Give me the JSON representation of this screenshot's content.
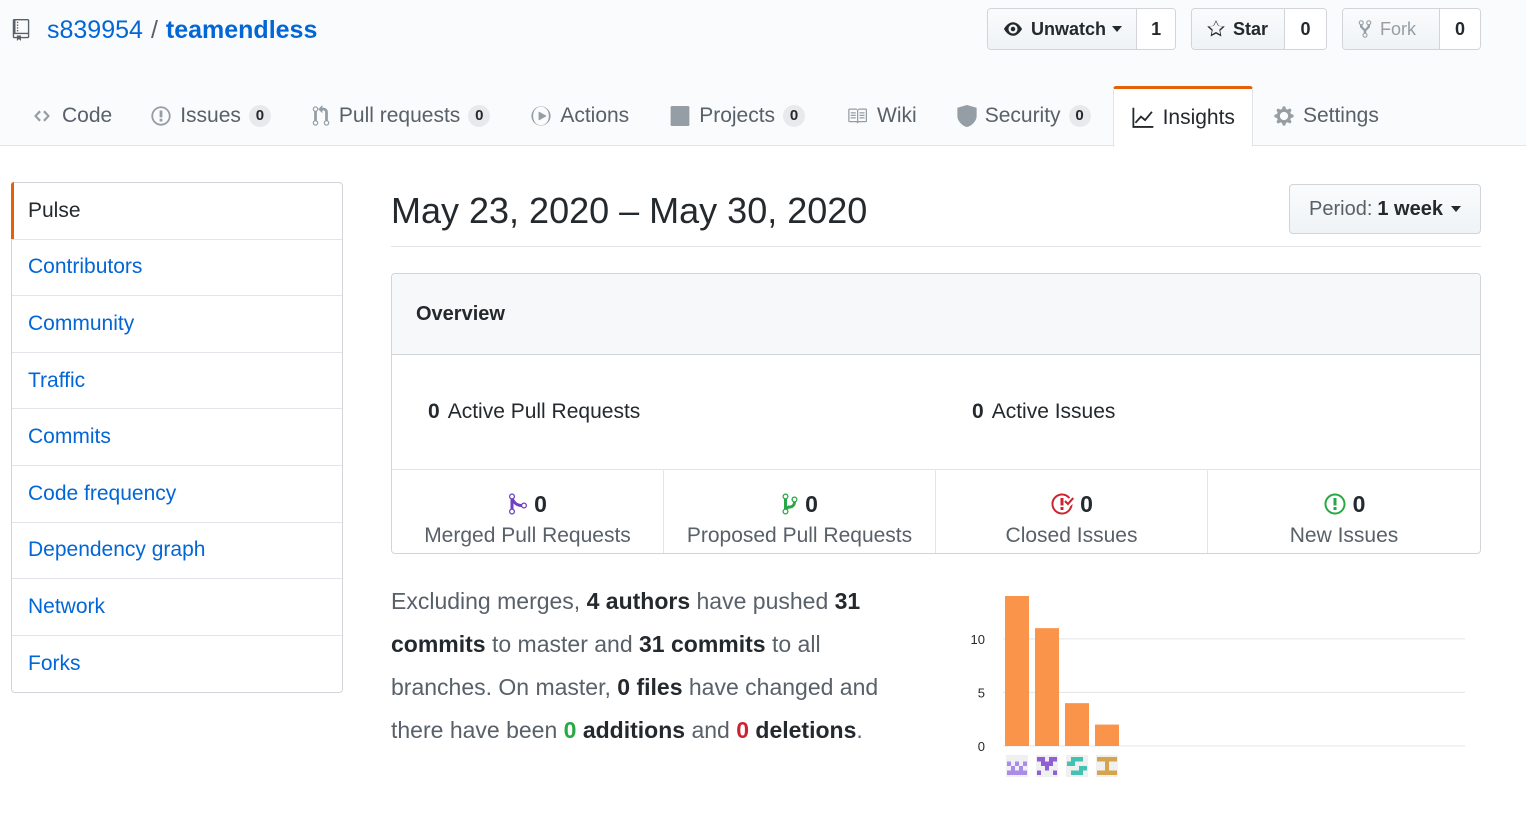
{
  "repo": {
    "owner": "s839954",
    "separator": "/",
    "name": "teamendless"
  },
  "actions": {
    "watch": {
      "label": "Unwatch",
      "count": "1"
    },
    "star": {
      "label": "Star",
      "count": "0"
    },
    "fork": {
      "label": "Fork",
      "count": "0"
    }
  },
  "tabs": [
    {
      "label": "Code",
      "icon": "code-icon"
    },
    {
      "label": "Issues",
      "counter": "0",
      "icon": "issue-icon"
    },
    {
      "label": "Pull requests",
      "counter": "0",
      "icon": "pull-request-icon"
    },
    {
      "label": "Actions",
      "icon": "play-icon"
    },
    {
      "label": "Projects",
      "counter": "0",
      "icon": "project-icon"
    },
    {
      "label": "Wiki",
      "icon": "book-icon"
    },
    {
      "label": "Security",
      "counter": "0",
      "icon": "shield-icon"
    },
    {
      "label": "Insights",
      "icon": "graph-icon",
      "selected": true
    },
    {
      "label": "Settings",
      "icon": "gear-icon"
    }
  ],
  "sidebar": {
    "items": [
      {
        "label": "Pulse",
        "selected": true
      },
      {
        "label": "Contributors"
      },
      {
        "label": "Community"
      },
      {
        "label": "Traffic"
      },
      {
        "label": "Commits"
      },
      {
        "label": "Code frequency"
      },
      {
        "label": "Dependency graph"
      },
      {
        "label": "Network"
      },
      {
        "label": "Forks"
      }
    ]
  },
  "pulse": {
    "date_range": "May 23, 2020 – May 30, 2020",
    "period_label": "Period:",
    "period_value": "1 week"
  },
  "overview": {
    "title": "Overview",
    "active_prs": {
      "count": "0",
      "label": "Active Pull Requests"
    },
    "active_issues": {
      "count": "0",
      "label": "Active Issues"
    },
    "stats": [
      {
        "count": "0",
        "label": "Merged Pull Requests",
        "icon": "git-merge-icon",
        "color": "#6f42c1"
      },
      {
        "count": "0",
        "label": "Proposed Pull Requests",
        "icon": "git-pull-request-icon",
        "color": "#28a745"
      },
      {
        "count": "0",
        "label": "Closed Issues",
        "icon": "issue-closed-icon",
        "color": "#cb2431"
      },
      {
        "count": "0",
        "label": "New Issues",
        "icon": "issue-opened-icon",
        "color": "#28a745"
      }
    ]
  },
  "summary": {
    "t1": "Excluding merges, ",
    "authors": "4 authors",
    "t2": " have pushed ",
    "commits_master": "31 commits",
    "t3": " to master and ",
    "commits_all": "31 commits",
    "t4": " to all branches. On master, ",
    "files": "0 files",
    "t5": " have changed and there have been ",
    "additions_num": "0",
    "additions_word": " additions",
    "t6": " and ",
    "deletions_num": "0",
    "deletions_word": " deletions",
    "t7": "."
  },
  "chart_data": {
    "type": "bar",
    "categories": [
      "author-1",
      "author-2",
      "author-3",
      "author-4"
    ],
    "values": [
      14,
      11,
      4,
      2
    ],
    "ylim": [
      0,
      14
    ],
    "yticks": [
      0,
      5,
      10
    ],
    "grid": true,
    "bar_color": "#f9944a",
    "avatar_colors": [
      "#a98bea",
      "#8f5fd6",
      "#44c2b1",
      "#d6a44c"
    ]
  }
}
